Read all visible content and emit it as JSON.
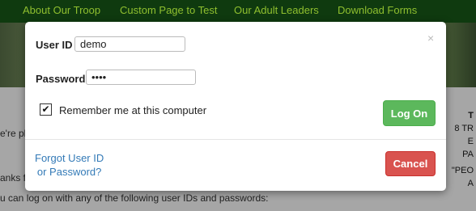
{
  "nav": {
    "items": [
      "About Our Troop",
      "Custom Page to Test",
      "Our Adult Leaders",
      "Download Forms"
    ]
  },
  "background": {
    "left_fragments": [
      "e're pl",
      "anks f"
    ],
    "bottom_line": "u can log on with any of the following user IDs and passwords:",
    "right_fragments": [
      "T",
      "8 TR",
      "E",
      "PA",
      "\"PEO",
      "A"
    ]
  },
  "login_modal": {
    "close_glyph": "×",
    "user_id_label": "User ID",
    "user_id_value": "demo",
    "password_label": "Password",
    "password_value": "••••",
    "remember_label": "Remember me at this computer",
    "remember_checked": true,
    "logon_label": "Log On",
    "forgot_line1": "Forgot User ID",
    "forgot_line2": "or Password?",
    "cancel_label": "Cancel"
  },
  "colors": {
    "nav_bg": "#0f3a0f",
    "nav_text": "#8fbf2f",
    "logon_green": "#5cb85c",
    "cancel_red": "#d9534f",
    "link_blue": "#337ab7"
  }
}
